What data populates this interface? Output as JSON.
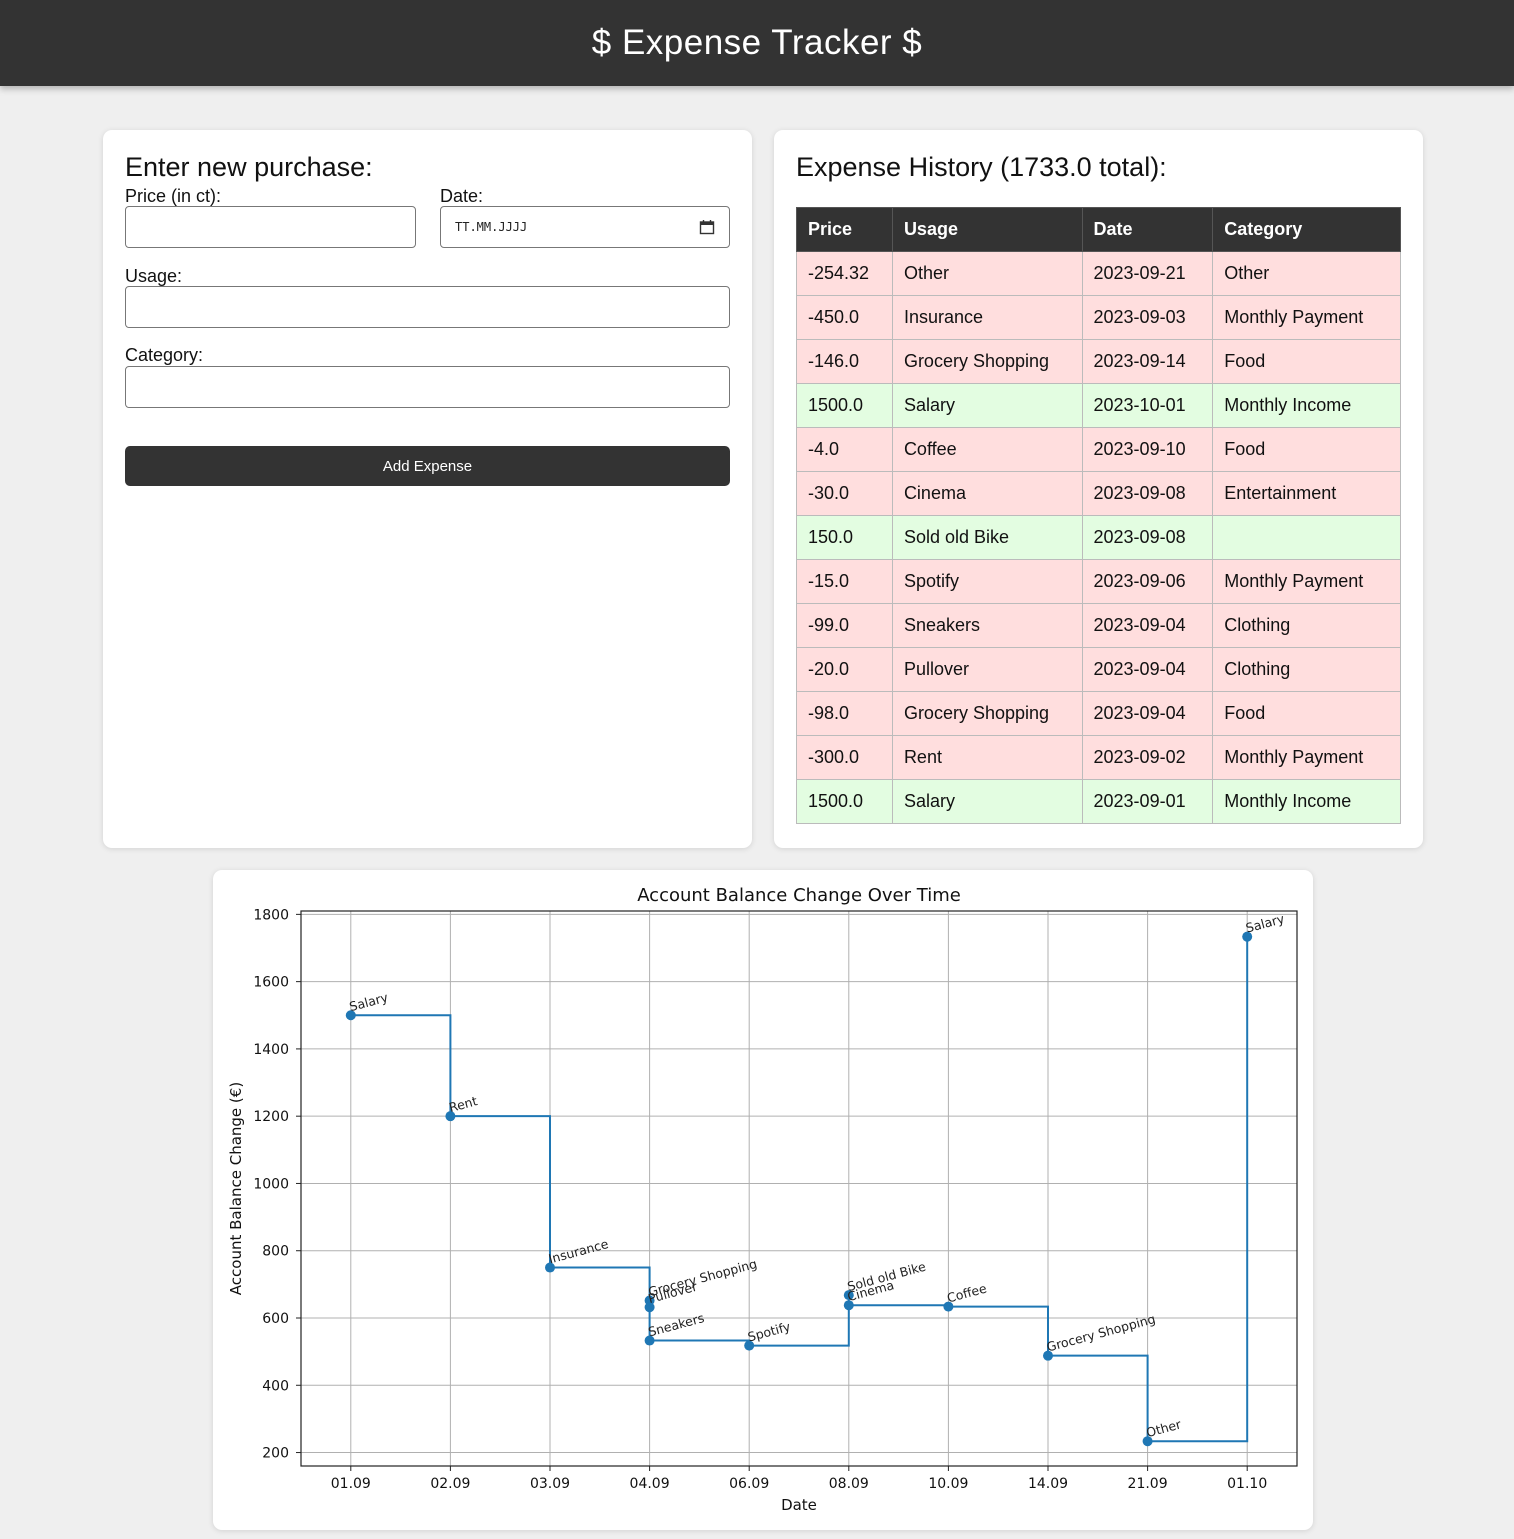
{
  "header": {
    "title": "$ Expense Tracker $"
  },
  "form": {
    "title": "Enter new purchase:",
    "price_label": "Price (in ct):",
    "price_value": "",
    "date_label": "Date:",
    "date_placeholder": "TT.MM.JJJJ",
    "usage_label": "Usage:",
    "usage_value": "",
    "category_label": "Category:",
    "category_value": "",
    "submit_label": "Add Expense"
  },
  "history": {
    "title": "Expense History (1733.0 total):",
    "columns": [
      "Price",
      "Usage",
      "Date",
      "Category"
    ],
    "rows": [
      {
        "price": "-254.32",
        "usage": "Other",
        "date": "2023-09-21",
        "category": "Other",
        "type": "neg"
      },
      {
        "price": "-450.0",
        "usage": "Insurance",
        "date": "2023-09-03",
        "category": "Monthly Payment",
        "type": "neg"
      },
      {
        "price": "-146.0",
        "usage": "Grocery Shopping",
        "date": "2023-09-14",
        "category": "Food",
        "type": "neg"
      },
      {
        "price": "1500.0",
        "usage": "Salary",
        "date": "2023-10-01",
        "category": "Monthly Income",
        "type": "pos"
      },
      {
        "price": "-4.0",
        "usage": "Coffee",
        "date": "2023-09-10",
        "category": "Food",
        "type": "neg"
      },
      {
        "price": "-30.0",
        "usage": "Cinema",
        "date": "2023-09-08",
        "category": "Entertainment",
        "type": "neg"
      },
      {
        "price": "150.0",
        "usage": "Sold old Bike",
        "date": "2023-09-08",
        "category": "",
        "type": "pos"
      },
      {
        "price": "-15.0",
        "usage": "Spotify",
        "date": "2023-09-06",
        "category": "Monthly Payment",
        "type": "neg"
      },
      {
        "price": "-99.0",
        "usage": "Sneakers",
        "date": "2023-09-04",
        "category": "Clothing",
        "type": "neg"
      },
      {
        "price": "-20.0",
        "usage": "Pullover",
        "date": "2023-09-04",
        "category": "Clothing",
        "type": "neg"
      },
      {
        "price": "-98.0",
        "usage": "Grocery Shopping",
        "date": "2023-09-04",
        "category": "Food",
        "type": "neg"
      },
      {
        "price": "-300.0",
        "usage": "Rent",
        "date": "2023-09-02",
        "category": "Monthly Payment",
        "type": "neg"
      },
      {
        "price": "1500.0",
        "usage": "Salary",
        "date": "2023-09-01",
        "category": "Monthly Income",
        "type": "pos"
      }
    ],
    "colors": {
      "negative_row": "#ffdede",
      "positive_row": "#e3fde1",
      "header_bg": "#333333"
    }
  },
  "chart_data": {
    "type": "line",
    "step": "post",
    "title": "Account Balance Change Over Time",
    "xlabel": "Date",
    "ylabel": "Account Balance Change (€)",
    "categories": [
      "01.09",
      "02.09",
      "03.09",
      "04.09",
      "06.09",
      "08.09",
      "10.09",
      "14.09",
      "21.09",
      "01.10"
    ],
    "ylim": [
      160,
      1810
    ],
    "yticks": [
      200,
      400,
      600,
      800,
      1000,
      1200,
      1400,
      1600,
      1800
    ],
    "grid": true,
    "color": "#1f77b4",
    "points": [
      {
        "cat": 0,
        "y": 1500.0,
        "label": "Salary"
      },
      {
        "cat": 1,
        "y": 1200.0,
        "label": "Rent"
      },
      {
        "cat": 2,
        "y": 750.0,
        "label": "Insurance"
      },
      {
        "cat": 3,
        "y": 652.0,
        "label": "Grocery Shopping"
      },
      {
        "cat": 3,
        "y": 632.0,
        "label": "Pullover"
      },
      {
        "cat": 3,
        "y": 533.0,
        "label": "Sneakers"
      },
      {
        "cat": 4,
        "y": 518.0,
        "label": "Spotify"
      },
      {
        "cat": 5,
        "y": 668.0,
        "label": "Sold old Bike"
      },
      {
        "cat": 5,
        "y": 638.0,
        "label": "Cinema"
      },
      {
        "cat": 6,
        "y": 634.0,
        "label": "Coffee"
      },
      {
        "cat": 7,
        "y": 488.0,
        "label": "Grocery Shopping"
      },
      {
        "cat": 8,
        "y": 233.68,
        "label": "Other"
      },
      {
        "cat": 9,
        "y": 1733.68,
        "label": "Salary"
      }
    ]
  }
}
